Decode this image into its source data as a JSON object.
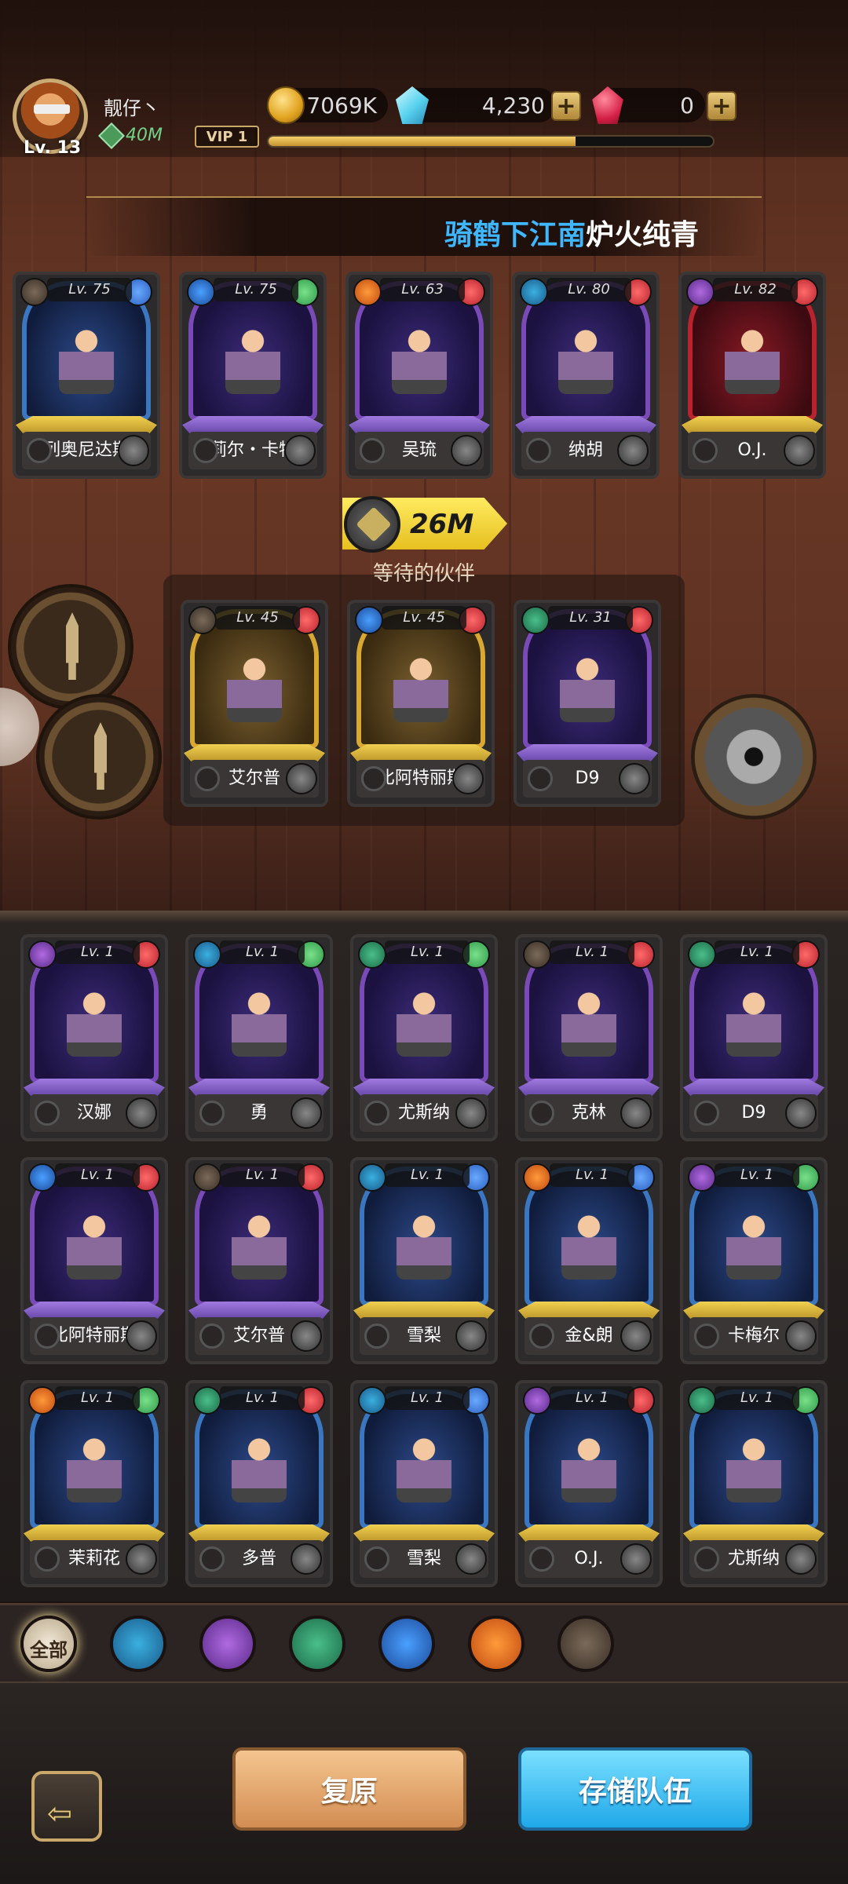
{
  "player": {
    "name": "靓仔丶",
    "level_label": "Lv. 13",
    "power": "40M",
    "vip": "VIP 1",
    "xp_fraction": 0.69
  },
  "resources": {
    "gold": "7069K",
    "crystal": "4,230",
    "ruby": "0"
  },
  "team_name": {
    "part1": "骑鹤下江南",
    "part2": "炉火纯青"
  },
  "team_power": "26M",
  "waiting_label": "等待的伙伴",
  "active_team": [
    {
      "name": "列奥尼达斯",
      "level": "Lv. 75",
      "color": "blue",
      "faction": "f-brown",
      "cls": "blue-c"
    },
    {
      "name": "莉尔・卡特",
      "level": "Lv. 75",
      "color": "purple",
      "faction": "f-blue",
      "cls": "green-c"
    },
    {
      "name": "吴琉",
      "level": "Lv. 63",
      "color": "purple",
      "faction": "f-orange",
      "cls": "red-c"
    },
    {
      "name": "纳胡",
      "level": "Lv. 80",
      "color": "purple",
      "faction": "f-gold",
      "cls": "red-c"
    },
    {
      "name": "O.J.",
      "level": "Lv. 82",
      "color": "red",
      "faction": "f-purple",
      "cls": "red-c"
    }
  ],
  "waiting": [
    {
      "name": "艾尔普",
      "level": "Lv. 45",
      "color": "gold",
      "faction": "f-brown",
      "cls": "red-c"
    },
    {
      "name": "比阿特丽斯",
      "level": "Lv. 45",
      "color": "gold",
      "faction": "f-blue",
      "cls": "red-c"
    },
    {
      "name": "D9",
      "level": "Lv. 31",
      "color": "purple",
      "faction": "f-green",
      "cls": "red-c"
    }
  ],
  "roster": [
    {
      "name": "汉娜",
      "level": "Lv. 1",
      "color": "purple",
      "faction": "f-purple",
      "cls": "red-c"
    },
    {
      "name": "勇",
      "level": "Lv. 1",
      "color": "purple",
      "faction": "f-gold",
      "cls": "green-c"
    },
    {
      "name": "尤斯纳",
      "level": "Lv. 1",
      "color": "purple",
      "faction": "f-green",
      "cls": "green-c"
    },
    {
      "name": "克林",
      "level": "Lv. 1",
      "color": "purple",
      "faction": "f-brown",
      "cls": "red-c"
    },
    {
      "name": "D9",
      "level": "Lv. 1",
      "color": "purple",
      "faction": "f-green",
      "cls": "red-c"
    },
    {
      "name": "比阿特丽斯",
      "level": "Lv. 1",
      "color": "purple",
      "faction": "f-blue",
      "cls": "red-c"
    },
    {
      "name": "艾尔普",
      "level": "Lv. 1",
      "color": "purple",
      "faction": "f-brown",
      "cls": "red-c"
    },
    {
      "name": "雪梨",
      "level": "Lv. 1",
      "color": "blue",
      "faction": "f-gold",
      "cls": "blue-c"
    },
    {
      "name": "金&朗",
      "level": "Lv. 1",
      "color": "blue",
      "faction": "f-orange",
      "cls": "blue-c"
    },
    {
      "name": "卡梅尔",
      "level": "Lv. 1",
      "color": "blue",
      "faction": "f-purple",
      "cls": "green-c"
    },
    {
      "name": "茉莉花",
      "level": "Lv. 1",
      "color": "blue",
      "faction": "f-orange",
      "cls": "green-c"
    },
    {
      "name": "多普",
      "level": "Lv. 1",
      "color": "blue",
      "faction": "f-green",
      "cls": "red-c"
    },
    {
      "name": "雪梨",
      "level": "Lv. 1",
      "color": "blue",
      "faction": "f-gold",
      "cls": "blue-c"
    },
    {
      "name": "O.J.",
      "level": "Lv. 1",
      "color": "blue",
      "faction": "f-purple",
      "cls": "red-c"
    },
    {
      "name": "尤斯纳",
      "level": "Lv. 1",
      "color": "blue",
      "faction": "f-green",
      "cls": "green-c"
    }
  ],
  "filters": [
    {
      "label": "全部",
      "icon": "all-filter"
    },
    {
      "label": "",
      "icon": "crown-faction-icon"
    },
    {
      "label": "",
      "icon": "trident-faction-icon"
    },
    {
      "label": "",
      "icon": "tree-faction-icon"
    },
    {
      "label": "",
      "icon": "anchor-faction-icon"
    },
    {
      "label": "",
      "icon": "dragon-faction-icon"
    },
    {
      "label": "",
      "icon": "eye-faction-icon"
    }
  ],
  "buttons": {
    "restore": "复原",
    "save": "存储队伍"
  }
}
